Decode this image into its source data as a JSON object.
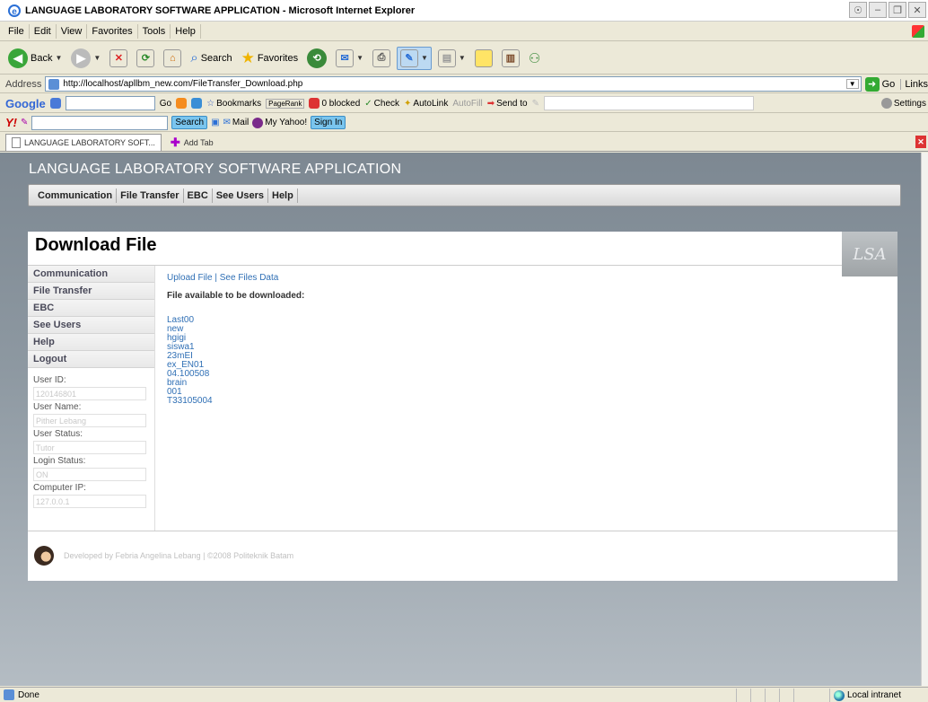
{
  "window": {
    "title": "LANGUAGE LABORATORY SOFTWARE APPLICATION - Microsoft Internet Explorer"
  },
  "menu": [
    "File",
    "Edit",
    "View",
    "Favorites",
    "Tools",
    "Help"
  ],
  "toolbar": {
    "back": "Back",
    "search": "Search",
    "favorites": "Favorites"
  },
  "address": {
    "label": "Address",
    "url": "http://localhost/apllbm_new.com/FileTransfer_Download.php",
    "go": "Go",
    "links": "Links"
  },
  "google": {
    "logo": "Google",
    "go": "Go",
    "bookmarks": "Bookmarks",
    "pagerank": "PageRank",
    "blocked": "0 blocked",
    "check": "Check",
    "autolink": "AutoLink",
    "autofill": "AutoFill",
    "sendto": "Send to",
    "settings": "Settings"
  },
  "yahoo": {
    "logo": "Y!",
    "search": "Search",
    "mail": "Mail",
    "my_yahoo": "My Yahoo!",
    "sign_in": "Sign In"
  },
  "tabs": {
    "active": "LANGUAGE LABORATORY SOFT...",
    "add": "Add Tab"
  },
  "app": {
    "title": "LANGUAGE LABORATORY SOFTWARE APPLICATION",
    "nav": [
      "Communication",
      "File Transfer",
      "EBC",
      "See Users",
      "Help"
    ],
    "page_title": "Download File",
    "logo_text": "LSA"
  },
  "sidebar": {
    "items": [
      "Communication",
      "File Transfer",
      "EBC",
      "See Users",
      "Help",
      "Logout"
    ],
    "user_id_label": "User ID:",
    "user_id": "120146801",
    "user_name_label": "User Name:",
    "user_name": "Pither Lebang",
    "user_status_label": "User Status:",
    "user_status": "Tutor",
    "login_status_label": "Login Status:",
    "login_status": "ON",
    "computer_ip_label": "Computer IP:",
    "computer_ip": "127.0.0.1"
  },
  "content": {
    "upload_link": "Upload File",
    "separator": " | ",
    "files_link": "See Files Data",
    "heading": "File available to be downloaded:",
    "files": [
      "Last00",
      "new",
      "hgigi",
      "siswa1",
      "23mEI",
      "ex_EN01",
      "04.100508",
      "brain",
      "001",
      "T33105004"
    ]
  },
  "footer": {
    "text": "Developed by Febria Angelina Lebang | ©2008 Politeknik Batam"
  },
  "status": {
    "left": "Done",
    "zone": "Local intranet"
  },
  "colors": {
    "link": "#2f6fb5",
    "header_bg": "#7d8892"
  }
}
